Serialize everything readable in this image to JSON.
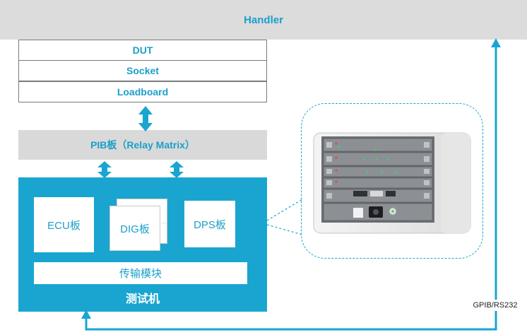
{
  "handler": {
    "label": "Handler"
  },
  "stack": {
    "dut": "DUT",
    "socket": "Socket",
    "loadboard": "Loadboard"
  },
  "pib": {
    "label": "PIB板（Relay Matrix）"
  },
  "tester": {
    "title": "测试机",
    "cards": {
      "ecu": "ECU板",
      "dig": "DIG板",
      "dig_more": "···",
      "dps": "DPS板"
    },
    "transfer": "传输模块"
  },
  "link": {
    "label": "GPIB/RS232"
  },
  "colors": {
    "accent": "#1aa5d1",
    "accent_text": "#1b9fc9",
    "gray_bar": "#dcdcdc",
    "white": "#ffffff"
  }
}
